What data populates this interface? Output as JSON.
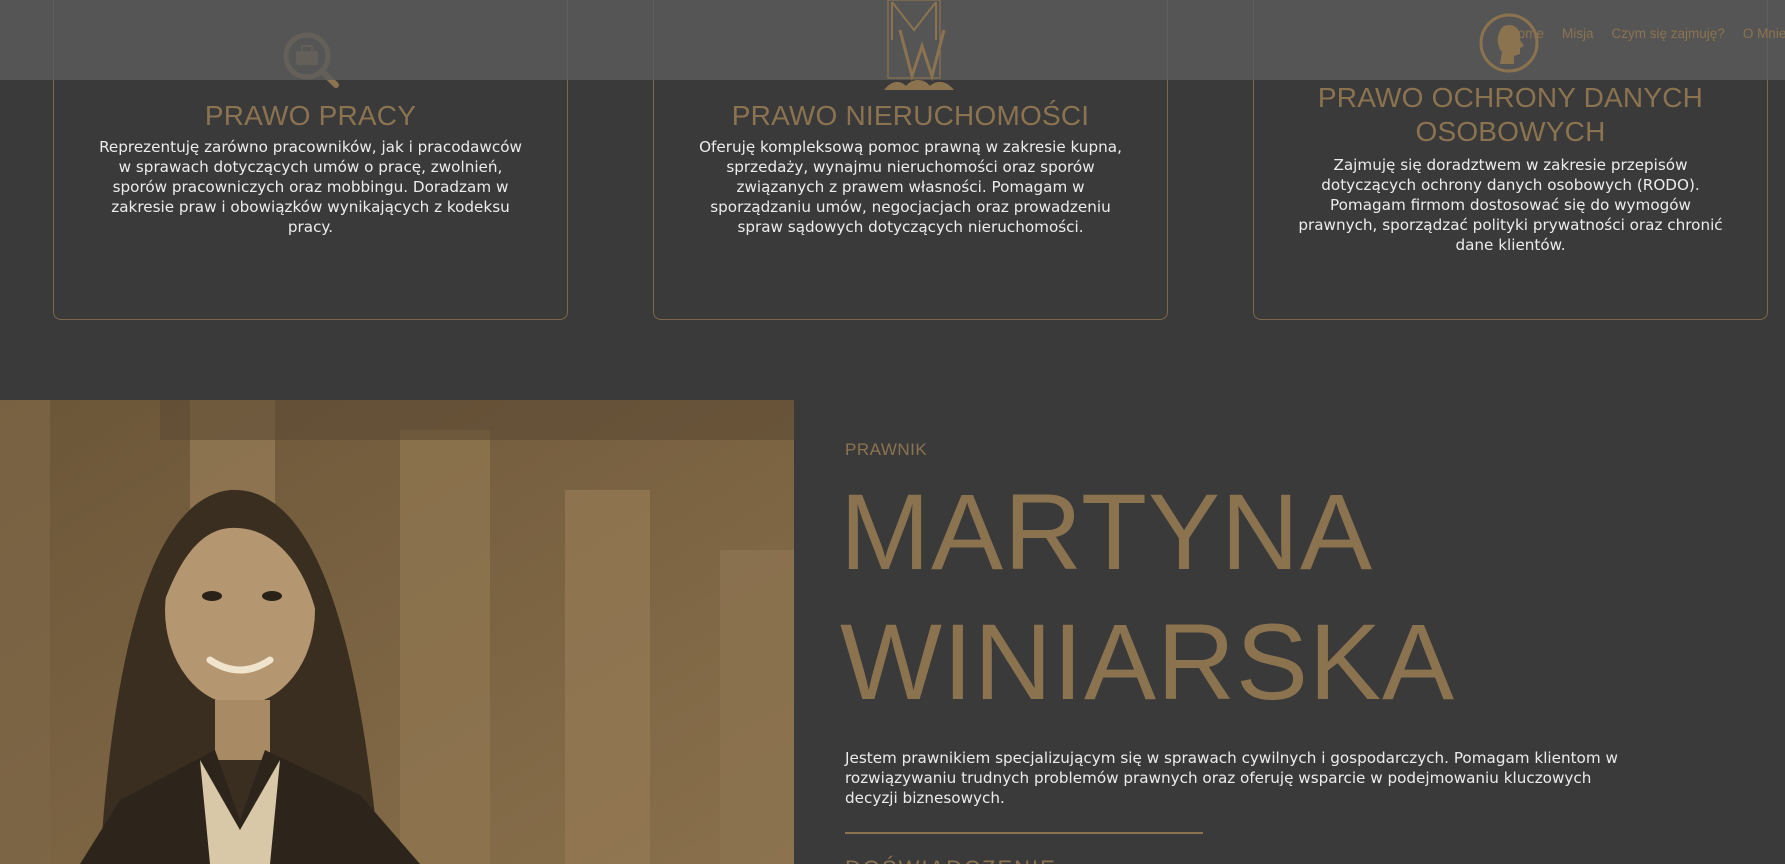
{
  "services": [
    {
      "title": "PRAWO PRACY",
      "text": "Reprezentuję zarówno pracowników, jak i pracodawców w sprawach dotyczących umów o pracę, zwolnień, sporów pracowniczych oraz mobbingu. Doradzam w zakresie praw i obowiązków wynikających z kodeksu pracy.",
      "icon": "briefcase-search-icon"
    },
    {
      "title": "PRAWO NIERUCHOMOŚCI",
      "text": "Oferuję kompleksową pomoc prawną w zakresie kupna, sprzedaży, wynajmu nieruchomości oraz sporów związanych z prawem własności. Pomagam w sporządzaniu umów, negocjacjach oraz prowadzeniu spraw sądowych dotyczących nieruchomości.",
      "icon": "building-icon"
    },
    {
      "title": "PRAWO OCHRONY DANYCH OSOBOWYCH",
      "text": "Zajmuję się doradztwem w zakresie przepisów dotyczących ochrony danych osobowych (RODO). Pomagam firmom dostosować się do wymogów prawnych, sporządzać polityki prywatności oraz chronić dane klientów.",
      "icon": "head-profile-icon"
    }
  ],
  "header": {
    "logo_icon": "mw-monogram-logo",
    "nav": [
      "Home",
      "Misja",
      "Czym się zajmuję?",
      "O Mnie"
    ]
  },
  "profile": {
    "role": "PRAWNIK",
    "first_name": "MARTYNA",
    "last_name": "WINIARSKA",
    "bio": "Jestem prawnikiem specjalizującym się w sprawach cywilnych i gospodarczych. Pomagam klientom w rozwiązywaniu trudnych problemów prawnych oraz oferuję wsparcie w podejmowaniu kluczowych decyzji biznesowych.",
    "next_heading": "DOŚWIADCZENIE"
  },
  "colors": {
    "accent": "#8c7350",
    "background": "#3a3a3a",
    "header": "#5c5c5c",
    "text": "#ececec"
  }
}
